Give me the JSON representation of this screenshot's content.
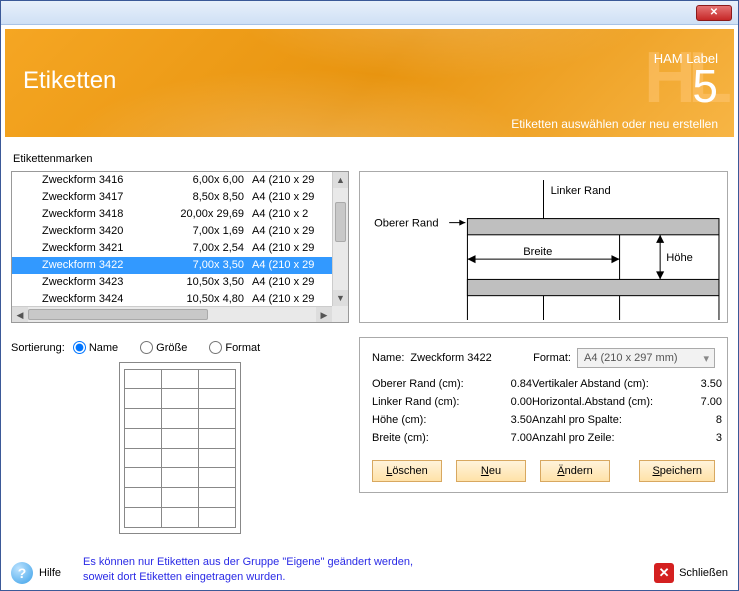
{
  "banner": {
    "title": "Etiketten",
    "brand_bg": "HL",
    "brand_label": "HAM Label",
    "brand_num": "5",
    "subhead": "Etiketten auswählen oder neu erstellen"
  },
  "list": {
    "label": "Etikettenmarken",
    "rows": [
      {
        "name": "Zweckform 3416",
        "dims": "6,00x 6,00",
        "fmt": "A4 (210 x 29",
        "selected": false
      },
      {
        "name": "Zweckform 3417",
        "dims": "8,50x 8,50",
        "fmt": "A4 (210 x 29",
        "selected": false
      },
      {
        "name": "Zweckform 3418",
        "dims": "20,00x 29,69",
        "fmt": "A4 (210 x 2",
        "selected": false
      },
      {
        "name": "Zweckform 3420",
        "dims": "7,00x 1,69",
        "fmt": "A4 (210 x 29",
        "selected": false
      },
      {
        "name": "Zweckform 3421",
        "dims": "7,00x 2,54",
        "fmt": "A4 (210 x 29",
        "selected": false
      },
      {
        "name": "Zweckform 3422",
        "dims": "7,00x 3,50",
        "fmt": "A4 (210 x 29",
        "selected": true
      },
      {
        "name": "Zweckform 3423",
        "dims": "10,50x 3,50",
        "fmt": "A4 (210 x 29",
        "selected": false
      },
      {
        "name": "Zweckform 3424",
        "dims": "10,50x 4,80",
        "fmt": "A4 (210 x 29",
        "selected": false
      }
    ]
  },
  "sort": {
    "label": "Sortierung:",
    "opt_name": "Name",
    "opt_size": "Größe",
    "opt_format": "Format",
    "selected": "name"
  },
  "diagram": {
    "linker_rand": "Linker Rand",
    "oberer_rand": "Oberer Rand",
    "breite": "Breite",
    "hoehe": "Höhe"
  },
  "detail": {
    "name_lbl": "Name:",
    "name_val": "Zweckform 3422",
    "format_lbl": "Format:",
    "format_val": "A4 (210 x 297 mm)",
    "oberer_lbl": "Oberer Rand (cm):",
    "oberer_val": "0.84",
    "linker_lbl": "Linker Rand (cm):",
    "linker_val": "0.00",
    "hoehe_lbl": "Höhe (cm):",
    "hoehe_val": "3.50",
    "breite_lbl": "Breite (cm):",
    "breite_val": "7.00",
    "vabst_lbl": "Vertikaler Abstand (cm):",
    "vabst_val": "3.50",
    "habst_lbl": "Horizontal.Abstand (cm):",
    "habst_val": "7.00",
    "spalte_lbl": "Anzahl pro Spalte:",
    "spalte_val": "8",
    "zeile_lbl": "Anzahl pro Zeile:",
    "zeile_val": "3"
  },
  "buttons": {
    "loeschen": "Löschen",
    "neu": "Neu",
    "aendern": "Ändern",
    "speichern": "Speichern"
  },
  "footer": {
    "hilfe": "Hilfe",
    "hint": "Es können nur Etiketten aus der Gruppe \"Eigene\" geändert werden, soweit dort Etiketten eingetragen wurden.",
    "schliessen": "Schließen"
  }
}
